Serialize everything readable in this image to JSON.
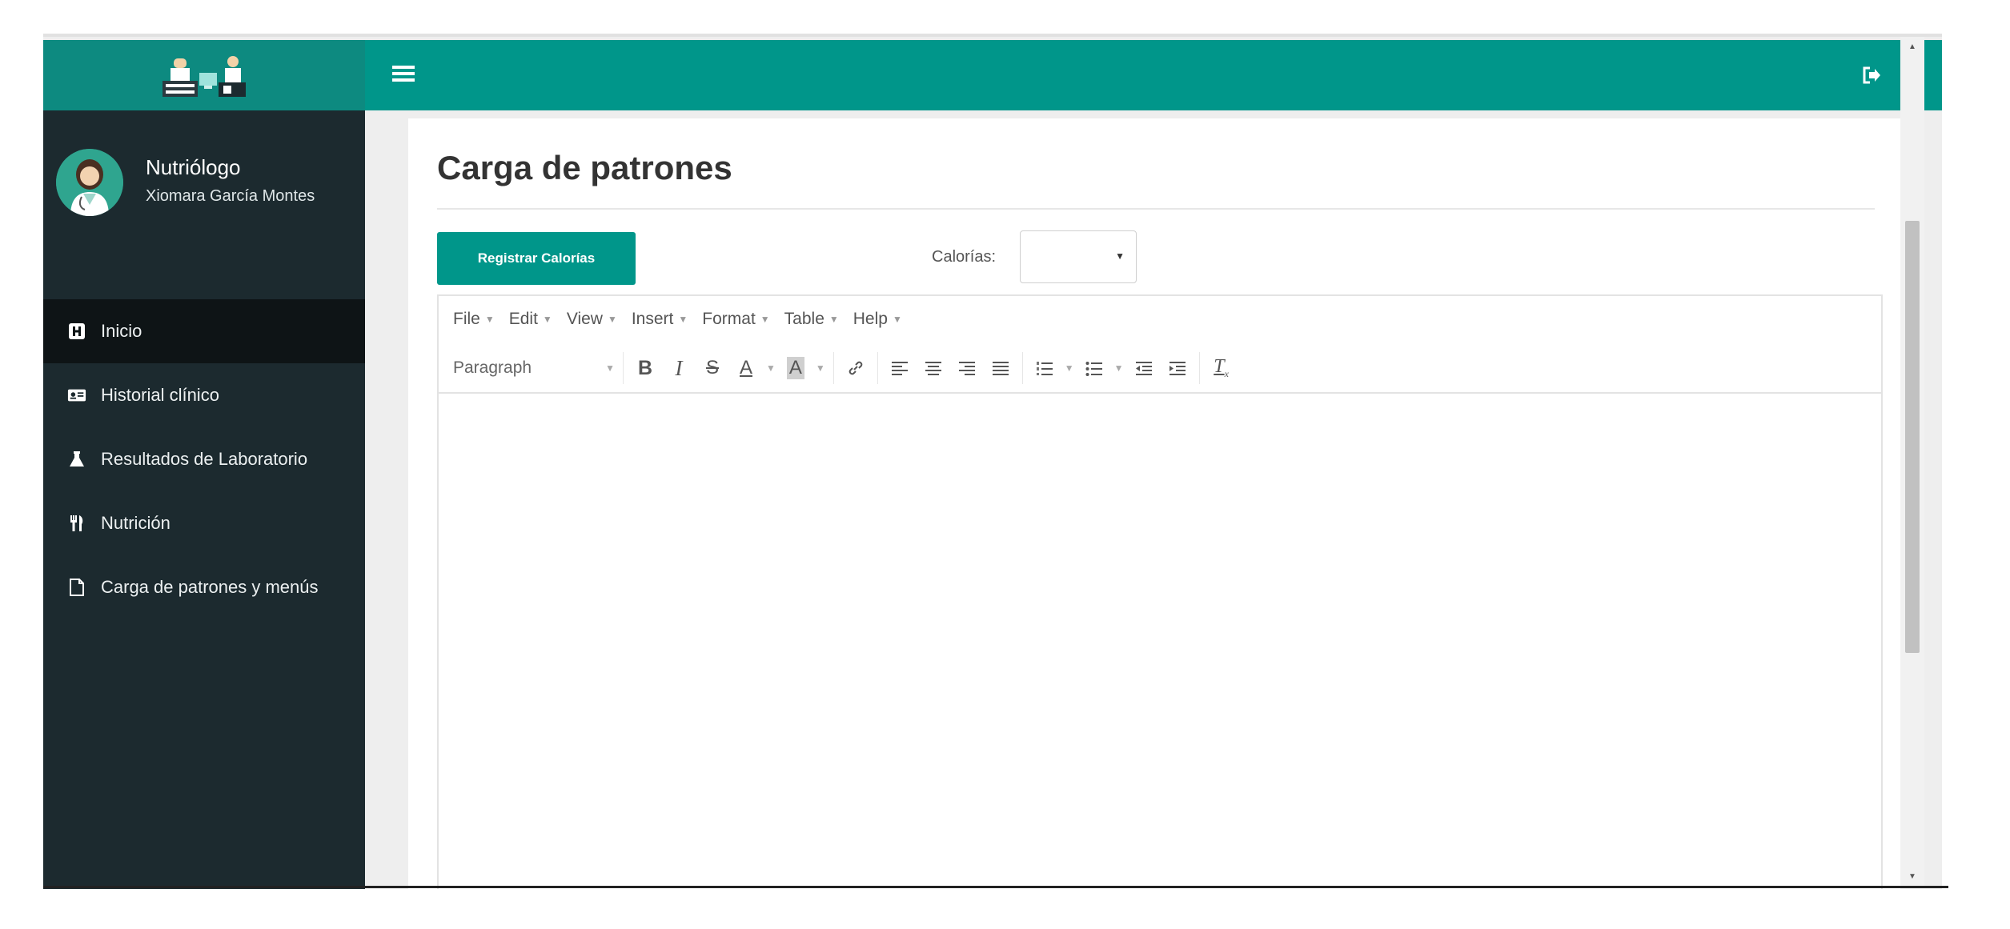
{
  "app": {
    "accent_color": "#00968a",
    "sidebar_color": "#1c2a2f",
    "logo_icon": "clinic-logo-icon"
  },
  "header": {
    "menu_icon": "hamburger-icon",
    "logout_icon": "logout-icon"
  },
  "user": {
    "role": "Nutriólogo",
    "name": "Xiomara García Montes",
    "avatar_icon": "doctor-avatar-icon"
  },
  "sidebar": {
    "items": [
      {
        "label": "Inicio",
        "icon": "home-icon",
        "active": true
      },
      {
        "label": "Historial clínico",
        "icon": "id-card-icon",
        "active": false
      },
      {
        "label": "Resultados de Laboratorio",
        "icon": "flask-icon",
        "active": false
      },
      {
        "label": "Nutrición",
        "icon": "utensils-icon",
        "active": false
      },
      {
        "label": "Carga de patrones y menús",
        "icon": "file-icon",
        "active": false
      }
    ]
  },
  "main": {
    "title": "Carga de patrones",
    "register_button": "Registrar Calorías",
    "calorias_label": "Calorías:",
    "calorias_value": ""
  },
  "editor": {
    "menus": [
      "File",
      "Edit",
      "View",
      "Insert",
      "Format",
      "Table",
      "Help"
    ],
    "paragraph_format": "Paragraph",
    "toolbar_icons": [
      "bold-icon",
      "italic-icon",
      "strikethrough-icon",
      "text-color-icon",
      "background-color-icon",
      "link-icon",
      "align-left-icon",
      "align-center-icon",
      "align-right-icon",
      "align-justify-icon",
      "numbered-list-icon",
      "bullet-list-icon",
      "outdent-icon",
      "indent-icon",
      "clear-formatting-icon"
    ],
    "content": ""
  }
}
